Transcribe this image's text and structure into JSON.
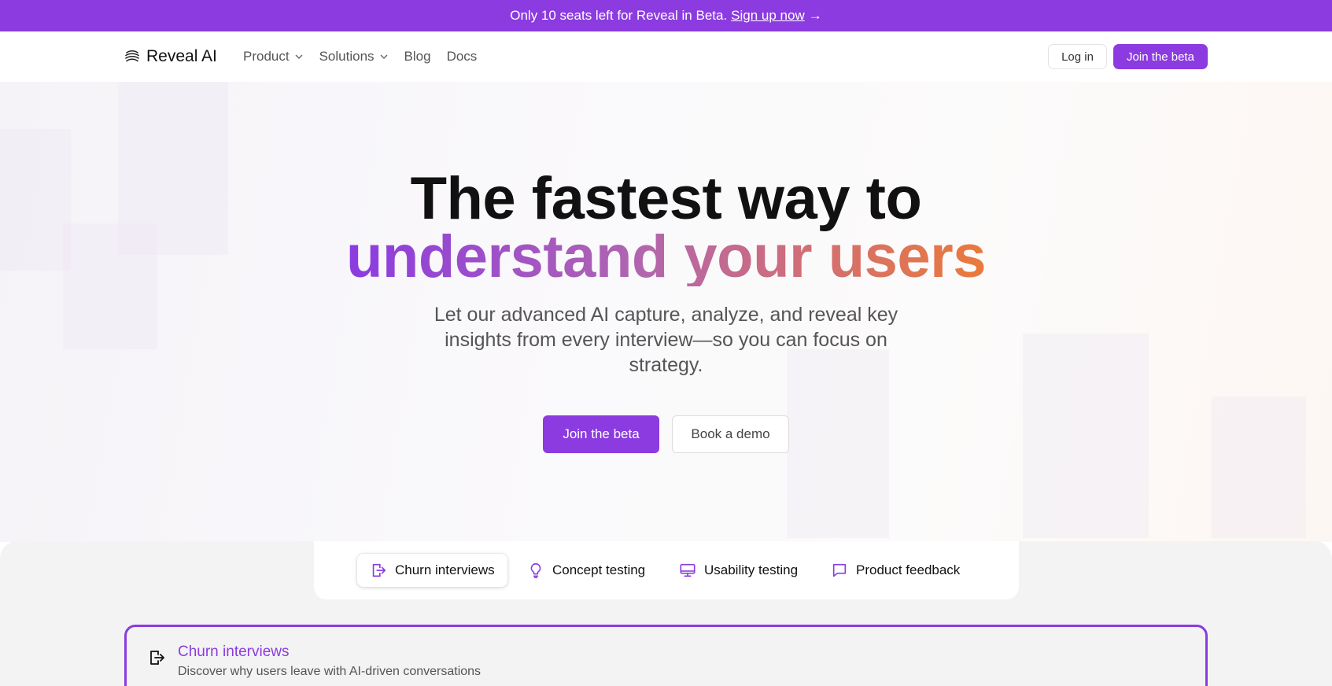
{
  "announcement": {
    "text": "Only 10 seats left for Reveal in Beta.",
    "link": "Sign up now",
    "arrow": "→"
  },
  "nav": {
    "brand": "Reveal AI",
    "links": [
      {
        "label": "Product",
        "dropdown": true
      },
      {
        "label": "Solutions",
        "dropdown": true
      },
      {
        "label": "Blog",
        "dropdown": false
      },
      {
        "label": "Docs",
        "dropdown": false
      }
    ],
    "login": "Log in",
    "join": "Join the beta"
  },
  "hero": {
    "title_line1": "The fastest way to",
    "title_line2": "understand your users",
    "subtitle": "Let our advanced AI capture, analyze, and reveal key insights from every interview—so you can focus on strategy.",
    "primary_cta": "Join the beta",
    "secondary_cta": "Book a demo"
  },
  "colors": {
    "accent": "#8b3be0",
    "gradient_end": "#ea7a3a"
  },
  "tabs": [
    {
      "label": "Churn interviews",
      "icon": "exit-door-icon",
      "active": true
    },
    {
      "label": "Concept testing",
      "icon": "lightbulb-icon",
      "active": false
    },
    {
      "label": "Usability testing",
      "icon": "monitor-icon",
      "active": false
    },
    {
      "label": "Product feedback",
      "icon": "chat-bubble-icon",
      "active": false
    }
  ],
  "panel": {
    "title": "Churn interviews",
    "description": "Discover why users leave with AI-driven conversations",
    "icon": "exit-door-icon"
  }
}
